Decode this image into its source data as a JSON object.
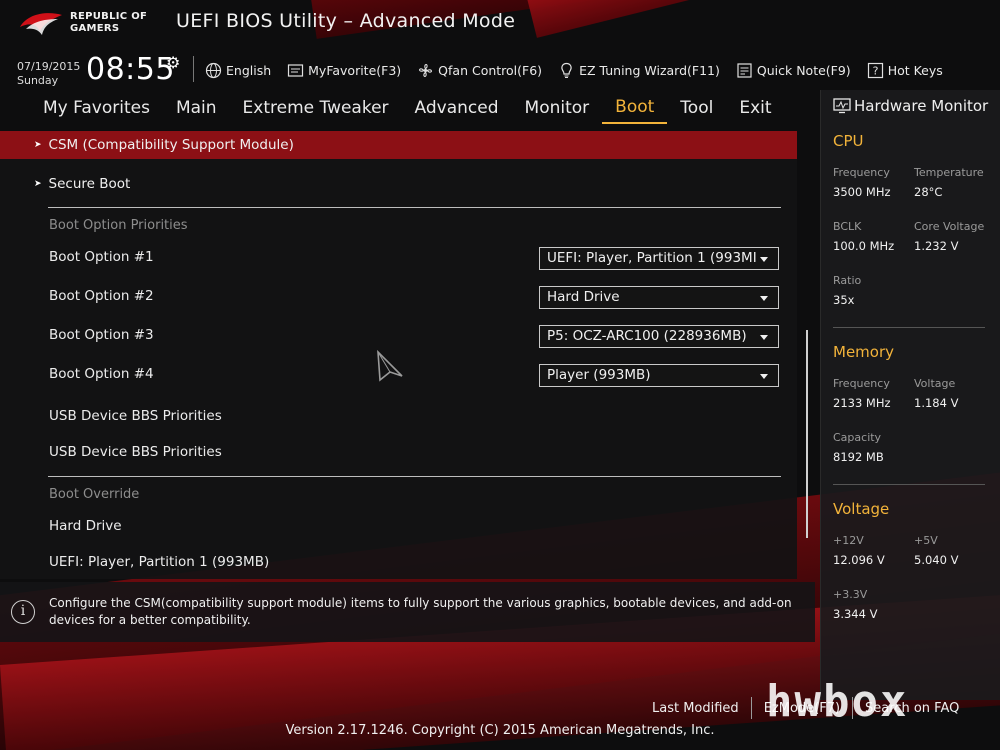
{
  "brand": {
    "logo_text_line1": "REPUBLIC OF",
    "logo_text_line2": "GAMERS",
    "app_title": "UEFI BIOS Utility – Advanced Mode"
  },
  "datetime": {
    "date": "07/19/2015",
    "day": "Sunday",
    "time": "08:55"
  },
  "toolbar": [
    {
      "label": "English",
      "icon": "globe-icon"
    },
    {
      "label": "MyFavorite(F3)",
      "icon": "favorite-icon"
    },
    {
      "label": "Qfan Control(F6)",
      "icon": "fan-icon"
    },
    {
      "label": "EZ Tuning Wizard(F11)",
      "icon": "bulb-icon"
    },
    {
      "label": "Quick Note(F9)",
      "icon": "note-icon"
    },
    {
      "label": "Hot Keys",
      "icon": "question-icon"
    }
  ],
  "menu": {
    "items": [
      "My Favorites",
      "Main",
      "Extreme Tweaker",
      "Advanced",
      "Monitor",
      "Boot",
      "Tool",
      "Exit"
    ],
    "active": "Boot"
  },
  "boot": {
    "csm": "CSM (Compatibility Support Module)",
    "secure_boot": "Secure Boot",
    "priorities_heading": "Boot Option Priorities",
    "options": [
      {
        "label": "Boot Option #1",
        "value": "UEFI:  Player, Partition 1 (993MI"
      },
      {
        "label": "Boot Option #2",
        "value": "Hard Drive"
      },
      {
        "label": "Boot Option #3",
        "value": "P5: OCZ-ARC100  (228936MB)"
      },
      {
        "label": "Boot Option #4",
        "value": " Player  (993MB)"
      }
    ],
    "usb_bbs_1": "USB Device BBS Priorities",
    "usb_bbs_2": "USB Device BBS Priorities",
    "override_heading": "Boot Override",
    "override_items": [
      "Hard Drive",
      "UEFI:  Player, Partition 1 (993MB)"
    ]
  },
  "help": {
    "icon": "info-icon",
    "text": "Configure the CSM(compatibility support module) items to fully support the various graphics, bootable devices, and add-on devices for a better compatibility."
  },
  "hardware_monitor": {
    "title": "Hardware Monitor",
    "cpu": {
      "heading": "CPU",
      "frequency_label": "Frequency",
      "frequency": "3500 MHz",
      "temperature_label": "Temperature",
      "temperature": "28°C",
      "bclk_label": "BCLK",
      "bclk": "100.0 MHz",
      "core_voltage_label": "Core Voltage",
      "core_voltage": "1.232 V",
      "ratio_label": "Ratio",
      "ratio": "35x"
    },
    "memory": {
      "heading": "Memory",
      "frequency_label": "Frequency",
      "frequency": "2133 MHz",
      "voltage_label": "Voltage",
      "voltage": "1.184 V",
      "capacity_label": "Capacity",
      "capacity": "8192 MB"
    },
    "voltage": {
      "heading": "Voltage",
      "v12_label": "+12V",
      "v12": "12.096 V",
      "v5_label": "+5V",
      "v5": "5.040 V",
      "v33_label": "+3.3V",
      "v33": "3.344 V"
    }
  },
  "footer": {
    "last_modified": "Last Modified",
    "ezmode": "EzMode(F7)",
    "search": "Search on FAQ",
    "version": "Version 2.17.1246. Copyright (C) 2015 American Megatrends, Inc.",
    "watermark": "hwbox"
  },
  "colors": {
    "accent": "#f2b33a",
    "highlight_row": "#8c1015"
  }
}
